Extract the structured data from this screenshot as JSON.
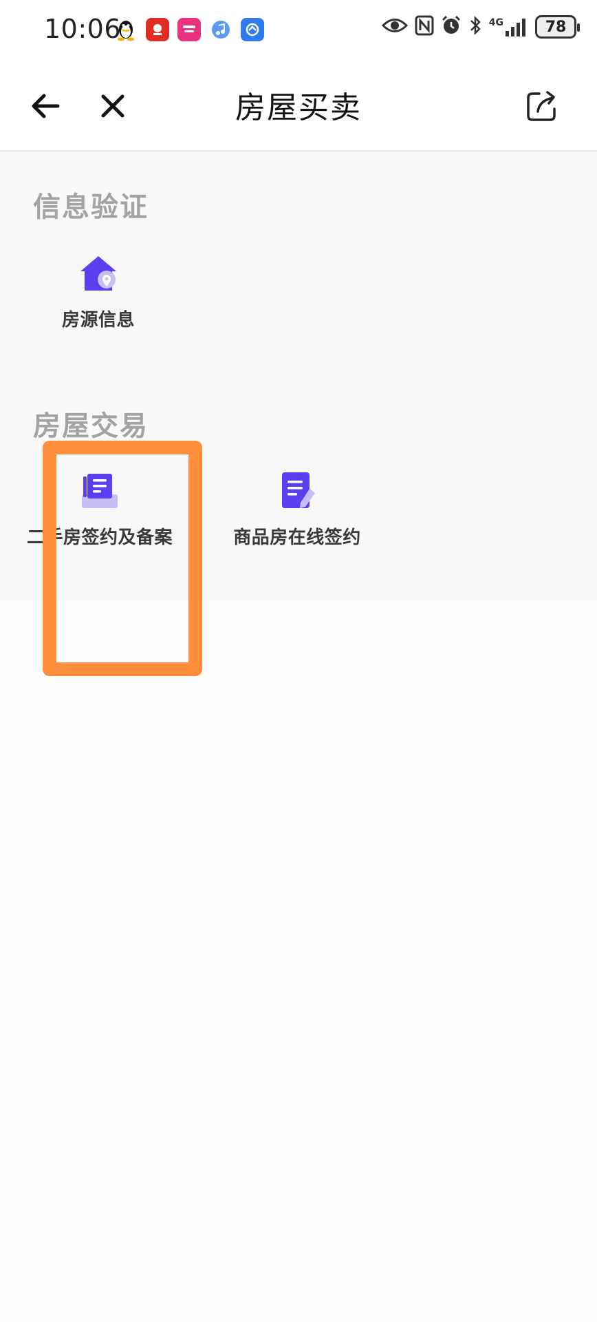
{
  "status_bar": {
    "time": "10:06",
    "battery": "78",
    "network": "4G"
  },
  "nav": {
    "title": "房屋买卖"
  },
  "sections": [
    {
      "title": "信息验证",
      "items": [
        {
          "label": "房源信息",
          "icon": "house-location-icon"
        }
      ]
    },
    {
      "title": "房屋交易",
      "items": [
        {
          "label": "二手房签约及备案",
          "icon": "document-tray-icon"
        },
        {
          "label": "商品房在线签约",
          "icon": "document-pen-icon"
        }
      ]
    }
  ],
  "colors": {
    "accent": "#5b3ef0",
    "accent_light": "#c9bdf7",
    "highlight": "#ff8f3c",
    "section_title": "#a3a3a3"
  }
}
